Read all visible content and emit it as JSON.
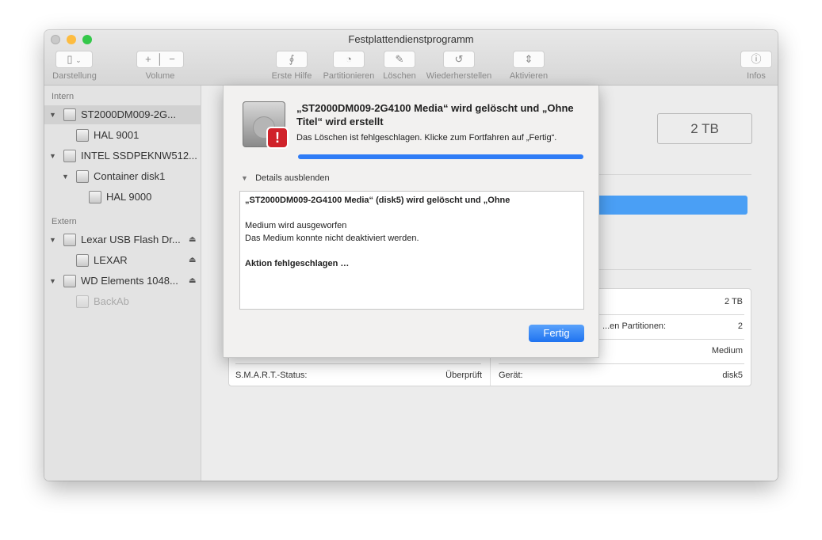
{
  "window": {
    "title": "Festplattendienstprogramm"
  },
  "toolbar": {
    "view": "Darstellung",
    "volume": "Volume",
    "first_aid": "Erste Hilfe",
    "partition": "Partitionieren",
    "erase": "Löschen",
    "restore": "Wiederherstellen",
    "mount": "Aktivieren",
    "info": "Infos"
  },
  "sidebar": {
    "internal": "Intern",
    "external": "Extern",
    "items": [
      {
        "label": "ST2000DM009-2G..."
      },
      {
        "label": "HAL 9001"
      },
      {
        "label": "INTEL SSDPEKNW512..."
      },
      {
        "label": "Container disk1"
      },
      {
        "label": "HAL 9000"
      },
      {
        "label": "Lexar USB Flash Dr..."
      },
      {
        "label": "LEXAR"
      },
      {
        "label": "WD Elements 1048..."
      },
      {
        "label": "BackAb"
      }
    ]
  },
  "main": {
    "capacity": "2 TB",
    "info": {
      "r1_value": "2 TB",
      "r2_label": "...en Partitionen:",
      "r2_value": "2",
      "r3_value": "Medium",
      "smart_label": "S.M.A.R.T.-Status:",
      "smart_value": "Überprüft",
      "device_label": "Gerät:",
      "device_value": "disk5"
    }
  },
  "dialog": {
    "title": "„ST2000DM009-2G4100 Media“ wird gelöscht und „Ohne Titel“ wird erstellt",
    "message": "Das Löschen ist fehlgeschlagen. Klicke zum Fortfahren auf „Fertig“.",
    "progress": 100,
    "details_toggle": "Details ausblenden",
    "log": [
      "„ST2000DM009-2G4100 Media“ (disk5) wird gelöscht und „Ohne",
      "Medium wird ausgeworfen",
      "Das Medium konnte nicht deaktiviert werden.",
      "Aktion fehlgeschlagen …"
    ],
    "done": "Fertig"
  },
  "colors": {
    "accent": "#2f7cf6"
  }
}
